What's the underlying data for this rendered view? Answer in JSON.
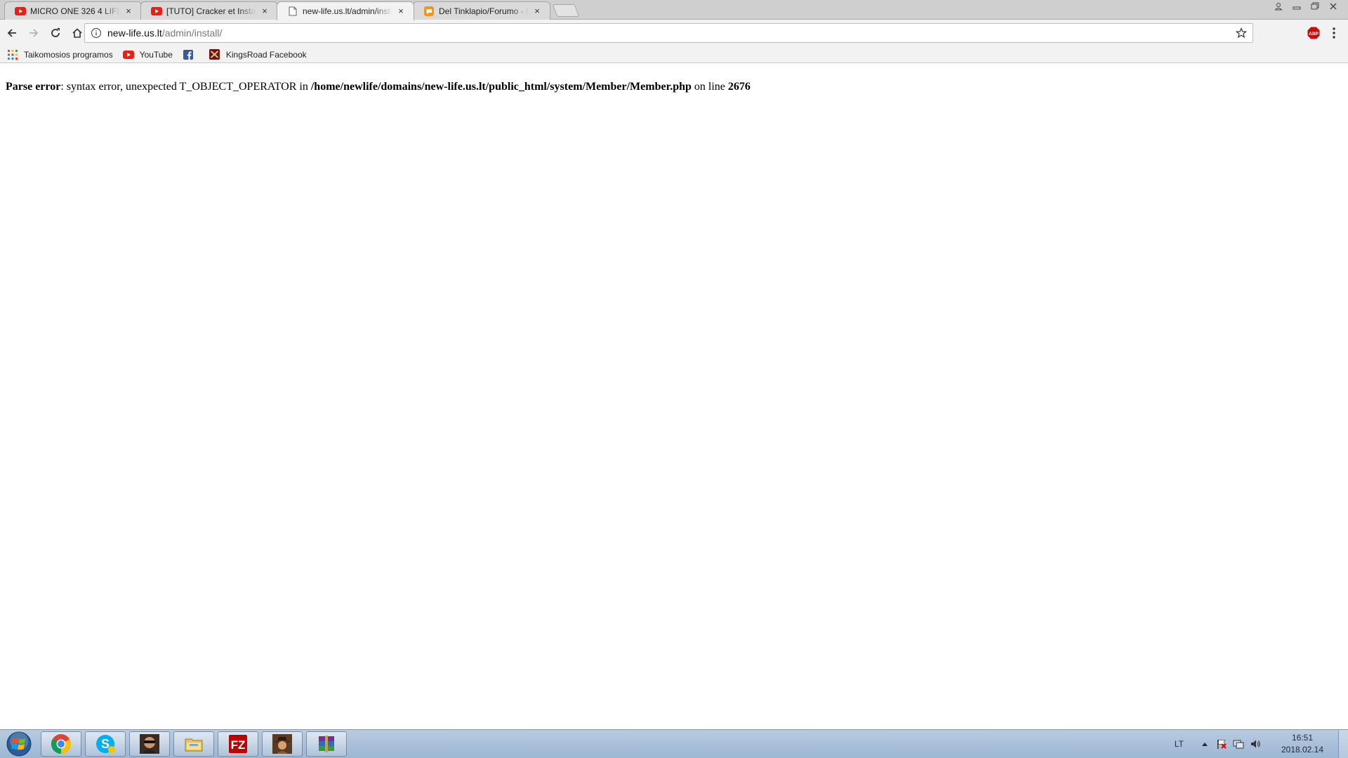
{
  "browser": {
    "tabs": [
      {
        "title": "MICRO ONE 326 4 LIFE -",
        "icon": "youtube-icon",
        "active": false
      },
      {
        "title": "[TUTO] Cracker et Installe",
        "icon": "youtube-icon",
        "active": false
      },
      {
        "title": "new-life.us.lt/admin/insta",
        "icon": "page-icon",
        "active": true
      },
      {
        "title": "Del Tinklapio/Forumo - F",
        "icon": "forum-icon",
        "active": false
      }
    ],
    "tab_close_glyph": "×",
    "address": {
      "host": "new-life.us.lt",
      "path": "/admin/install/"
    },
    "bookmarks": [
      {
        "label": "Taikomosios programos",
        "icon": "apps-grid-icon"
      },
      {
        "label": "YouTube",
        "icon": "youtube-icon"
      },
      {
        "label": "",
        "icon": "facebook-icon"
      },
      {
        "label": "KingsRoad Facebook",
        "icon": "kingsroad-icon"
      }
    ],
    "colors": {
      "youtube_red": "#e62117",
      "facebook_blue": "#3b5998",
      "abp_red": "#c70d0d"
    }
  },
  "page": {
    "error_label": "Parse error",
    "error_message": ": syntax error, unexpected T_OBJECT_OPERATOR in ",
    "error_file": "/home/newlife/domains/new-life.us.lt/public_html/system/Member/Member.php",
    "error_on_line": " on line ",
    "error_line_number": "2676"
  },
  "taskbar": {
    "apps": [
      "chrome-icon",
      "skype-icon",
      "avatar-app-icon",
      "file-explorer-icon",
      "filezilla-icon",
      "cowboy-app-icon",
      "winrar-icon"
    ],
    "language": "LT",
    "time": "16:51",
    "date": "2018.02.14"
  }
}
